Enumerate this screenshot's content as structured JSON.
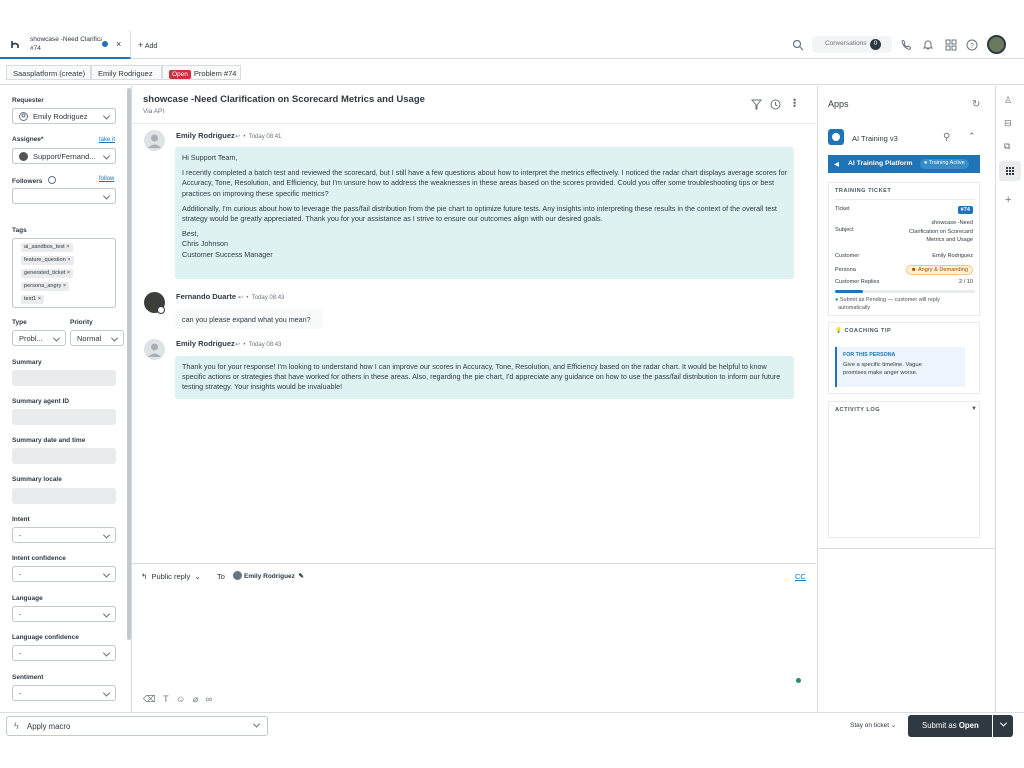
{
  "tab": {
    "title": "showcase -Need Clarificat",
    "number": "#74",
    "add_label": "Add"
  },
  "topbar": {
    "conversations_label": "Conversations",
    "conversations_count": "0"
  },
  "breadcrumbs": {
    "org": "Saasplatform (create)",
    "user": "Emily Rodriguez",
    "status": "Open",
    "ticket": "Problem #74"
  },
  "left": {
    "requester_label": "Requester",
    "requester_value": "Emily Rodriguez",
    "assignee_label": "Assignee*",
    "take_it": "take it",
    "assignee_value": "Support/Fernand...",
    "followers_label": "Followers",
    "follow": "follow",
    "tags_label": "Tags",
    "tags": [
      "ai_sandbox_test",
      "feature_question",
      "generated_ticket",
      "persona_angry",
      "test1"
    ],
    "type_label": "Type",
    "type_value": "Probl...",
    "priority_label": "Priority",
    "priority_value": "Normal",
    "summary_label": "Summary",
    "summary_agent_label": "Summary agent ID",
    "summary_date_label": "Summary date and time",
    "summary_locale_label": "Summary locale",
    "intent_label": "Intent",
    "intent_value": "-",
    "intent_conf_label": "Intent confidence",
    "intent_conf_value": "-",
    "language_label": "Language",
    "language_value": "-",
    "language_conf_label": "Language confidence",
    "language_conf_value": "-",
    "sentiment_label": "Sentiment",
    "sentiment_value": "-"
  },
  "ticket": {
    "subject": "showcase -Need Clarification on Scorecard Metrics and Usage",
    "via": "Via API"
  },
  "messages": [
    {
      "author": "Emily Rodriguez",
      "time": "Today 08:41",
      "p1": "Hi Support Team,",
      "p2": "I recently completed a batch test and reviewed the scorecard, but I still have a few questions about how to interpret the metrics effectively. I noticed the radar chart displays average scores for Accuracy, Tone, Resolution, and Efficiency, but I'm unsure how to address the weaknesses in these areas based on the scores provided. Could you offer some troubleshooting tips or best practices on improving these specific metrics?",
      "p3": "Additionally, I'm curious about how to leverage the pass/fail distribution from the pie chart to optimize future tests. Any insights into interpreting these results in the context of the overall test strategy would be greatly appreciated. Thank you for your assistance as I strive to ensure our outcomes align with our desired goals.",
      "sign1": "Best,",
      "sign2": "Chris Johnson",
      "sign3": "Customer Success Manager"
    },
    {
      "author": "Fernando Duarte",
      "time": "Today 08:43",
      "text": "can you please expand what you mean?"
    },
    {
      "author": "Emily Rodriguez",
      "time": "Today 08:43",
      "text": "Thank you for your response! I'm looking to understand how I can improve our scores in Accuracy, Tone, Resolution, and Efficiency based on the radar chart. It would be helpful to know specific actions or strategies that have worked for others in these areas. Also, regarding the pie chart, I'd appreciate any guidance on how to use the pass/fail distribution to inform our future testing strategy. Your insights would be invaluable!"
    }
  ],
  "reply": {
    "mode": "Public reply",
    "to_label": "To",
    "to_value": "Emily Rodriguez",
    "cc": "CC"
  },
  "apps": {
    "title": "Apps",
    "app_name": "AI Training v3",
    "platform": "AI Training Platform",
    "status": "Training Active",
    "training_ticket": "TRAINING TICKET",
    "ticket_k": "Ticket",
    "ticket_v": "#74",
    "subject_k": "Subject",
    "subject_v1": "showcase -Need",
    "subject_v2": "Clarification on Scorecard",
    "subject_v3": "Metrics and Usage",
    "customer_k": "Customer",
    "customer_v": "Emily Rodriguez",
    "persona_k": "Persona",
    "persona_v": "Angry & Demanding",
    "replies_k": "Customer Replies",
    "replies_v": "2 / 10",
    "replies_fraction": 0.2,
    "submit_note1": "Submit as Pending — customer will reply",
    "submit_note2": "automatically",
    "coaching": "COACHING TIP",
    "for_persona": "FOR THIS PERSONA",
    "tip1": "Give a specific timeline. Vague",
    "tip2": "promises make anger worse.",
    "activity": "ACTIVITY LOG"
  },
  "bottom": {
    "macro": "Apply macro",
    "stay": "Stay on ticket",
    "submit_prefix": "Submit as ",
    "submit_status": "Open"
  }
}
